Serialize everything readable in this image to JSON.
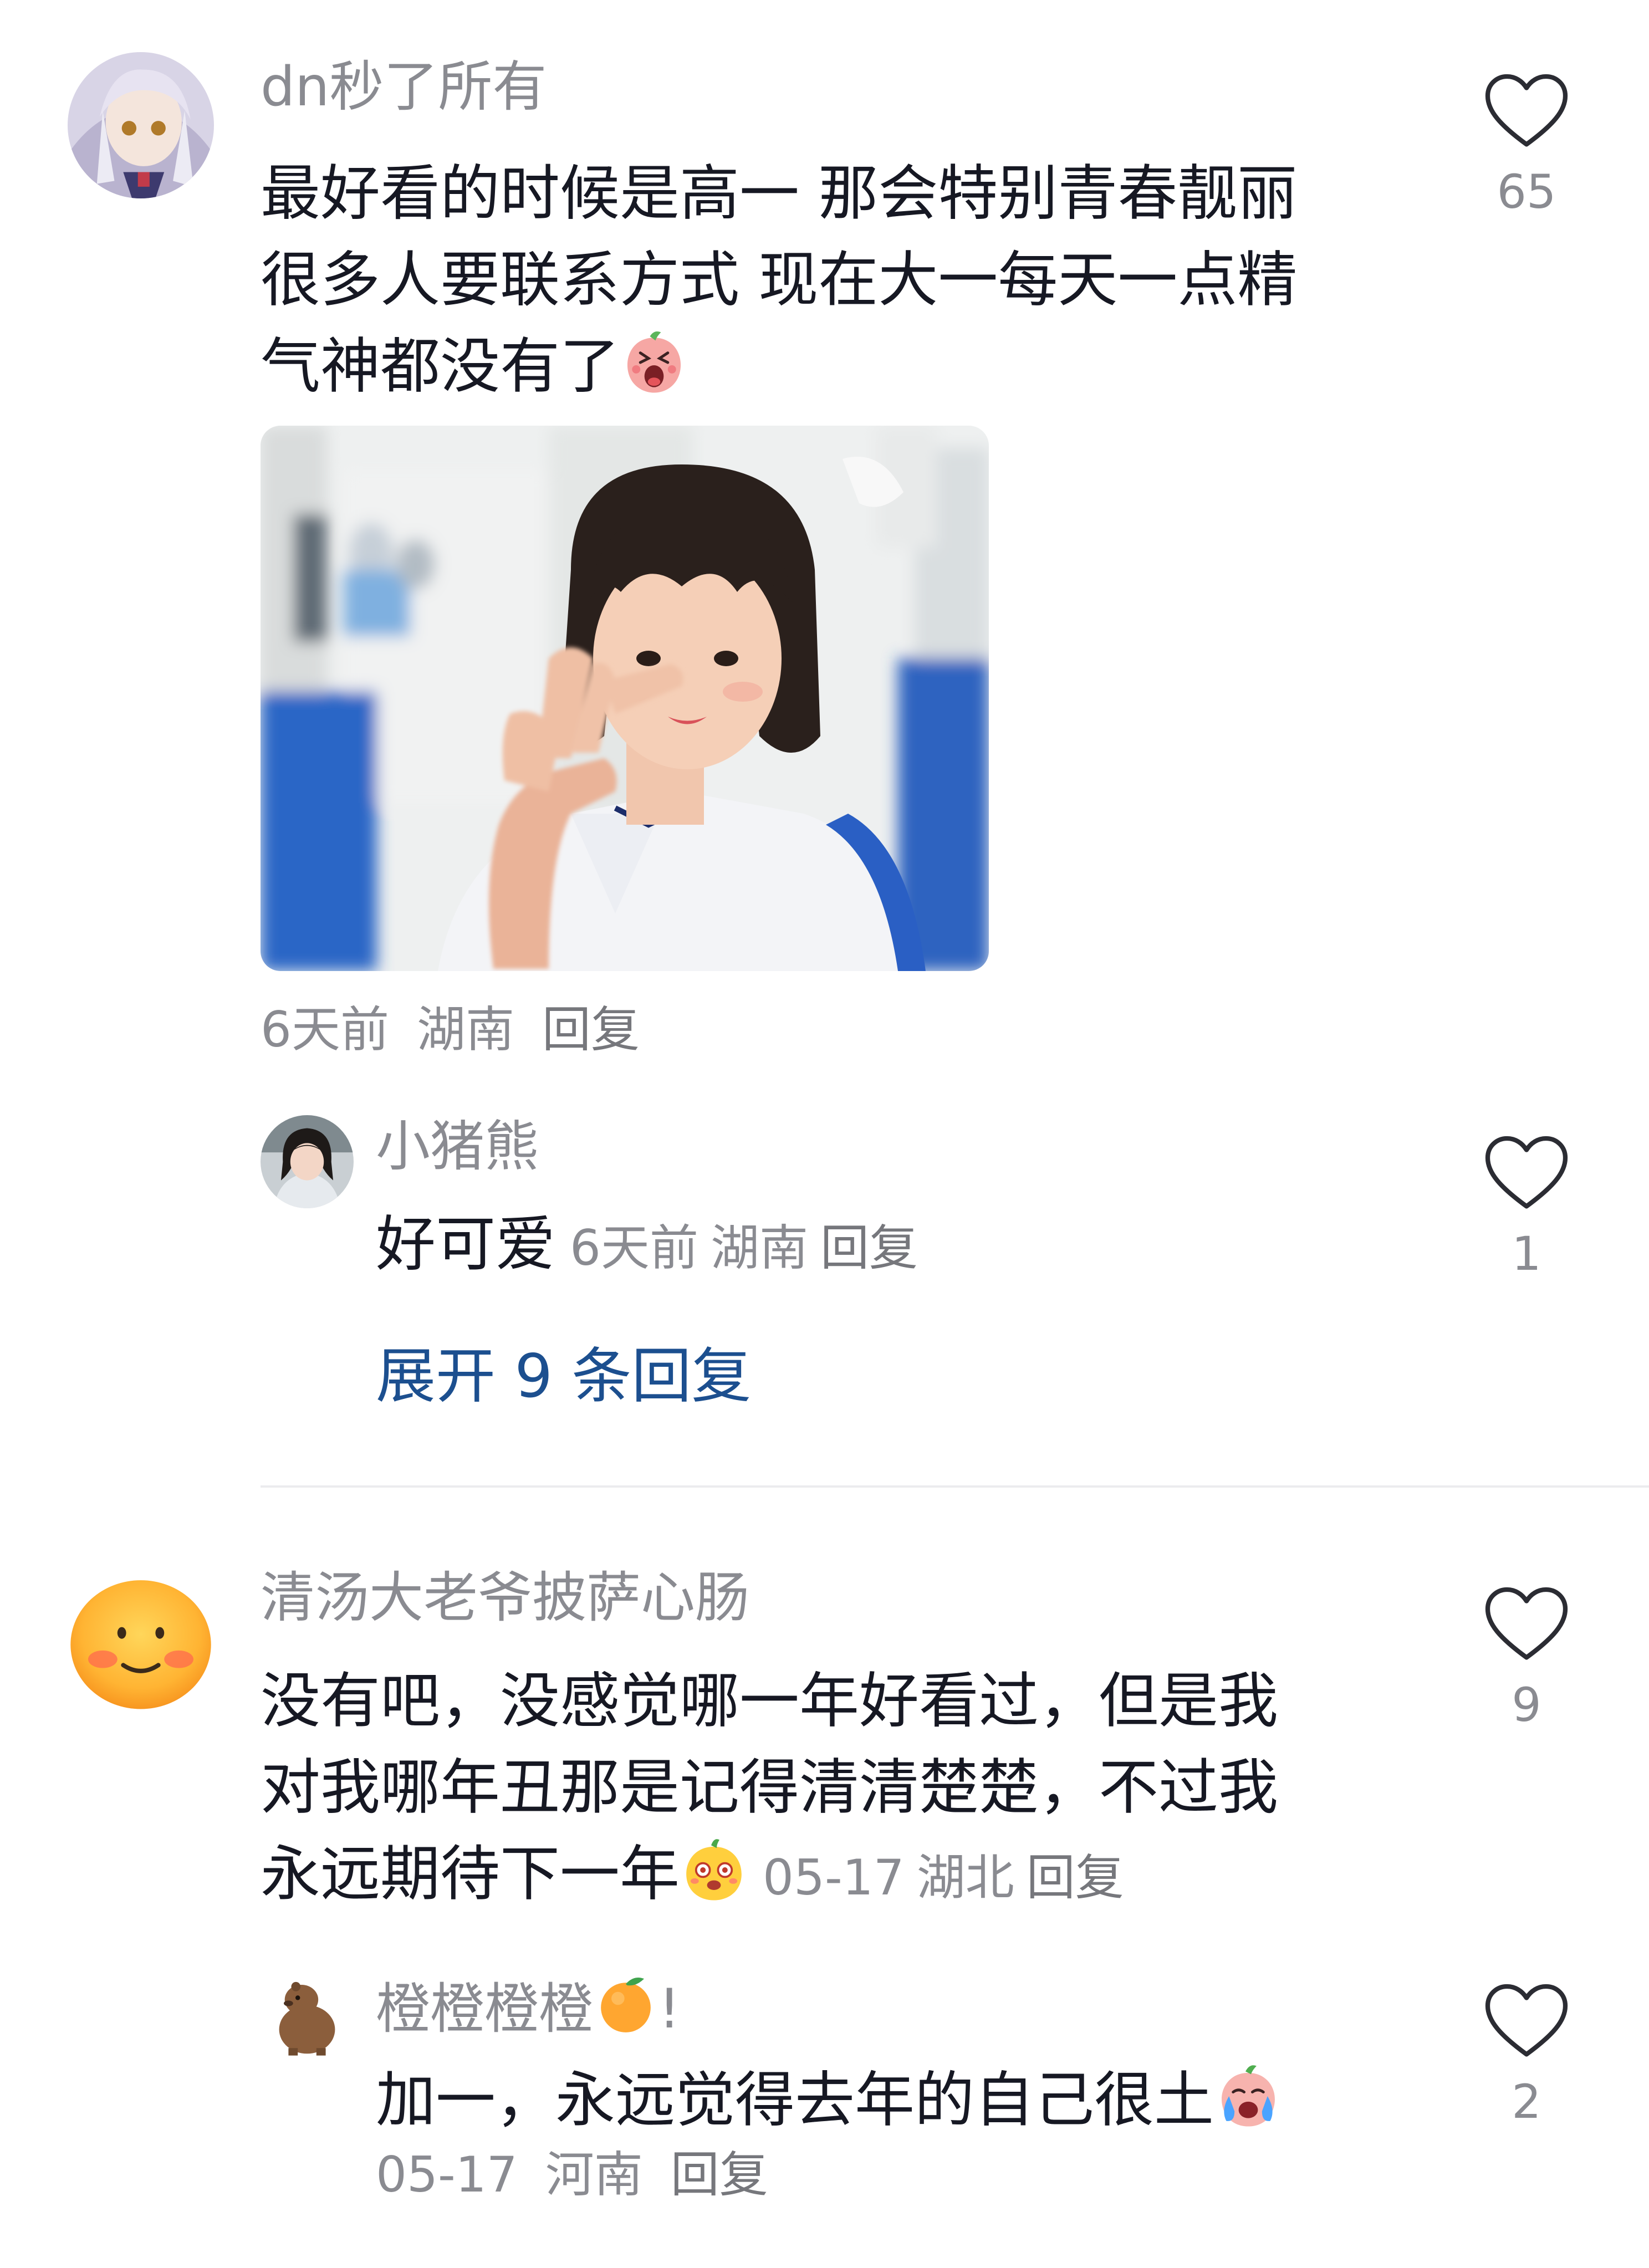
{
  "comments": [
    {
      "username": "dn秒了所有",
      "text_lines": [
        "最好看的时候是高一 那会特别青春靓丽",
        "很多人要联系方式 现在大一每天一点精",
        "气神都没有了"
      ],
      "time": "6天前",
      "location": "湖南",
      "reply_label": "回复",
      "likes": "65",
      "replies": [
        {
          "username": "小猪熊",
          "text": "好可爱",
          "time": "6天前",
          "location": "湖南",
          "reply_label": "回复",
          "likes": "1"
        }
      ],
      "expand_label": "展开 9 条回复"
    },
    {
      "username": "清汤大老爷披萨心肠",
      "text_lines": [
        "没有吧，没感觉哪一年好看过，但是我",
        "对我哪年丑那是记得清清楚楚，不过我",
        "永远期待下一年"
      ],
      "time": "05-17",
      "location": "湖北",
      "reply_label": "回复",
      "likes": "9",
      "replies": [
        {
          "username": "橙橙橙橙",
          "username_suffix": "!",
          "text": "加一，永远觉得去年的自己很土",
          "time": "05-17",
          "location": "河南",
          "reply_label": "回复",
          "likes": "2"
        }
      ]
    }
  ],
  "icons": {
    "like": "heart-outline-icon",
    "emoji_1": "screaming-peach-emoji",
    "emoji_2": "dizzy-face-emoji",
    "emoji_3": "crying-peach-emoji",
    "username_emoji": "orange-fruit-emoji"
  },
  "colors": {
    "text_primary": "#161823",
    "text_secondary": "#8a8b91",
    "link_blue": "#1c4f8f",
    "divider": "#ececee"
  }
}
